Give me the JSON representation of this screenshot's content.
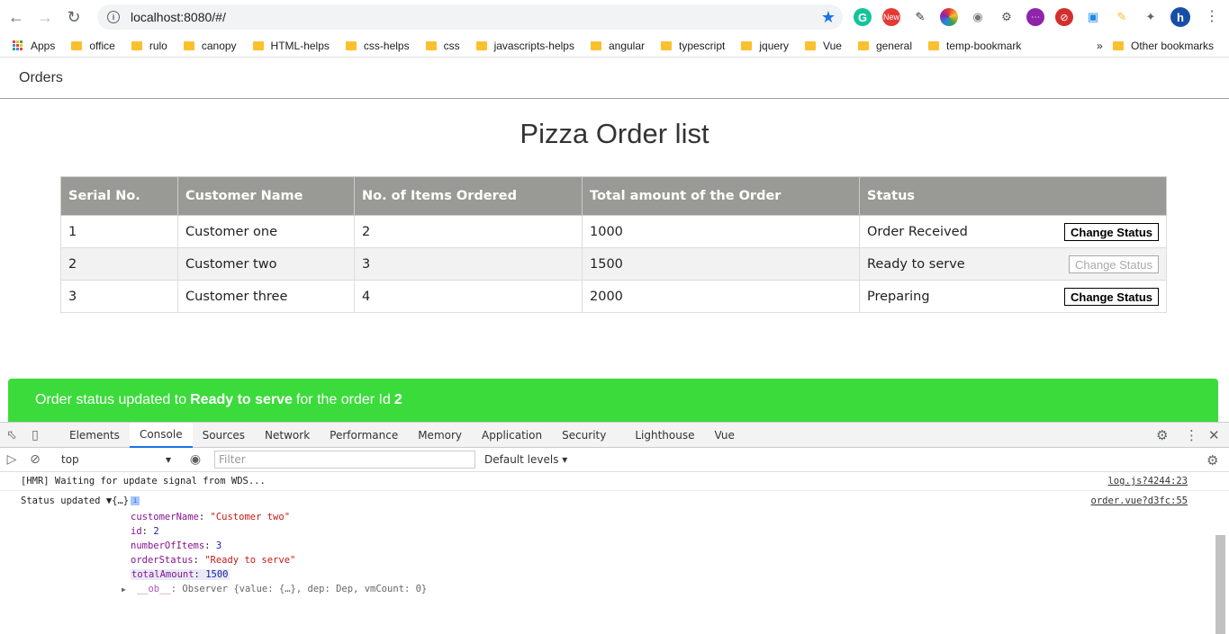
{
  "browser": {
    "url": "localhost:8080/#/",
    "profile_initial": "h",
    "ext_new_badge": "New",
    "bookmarks": [
      "Apps",
      "office",
      "rulo",
      "canopy",
      "HTML-helps",
      "css-helps",
      "css",
      "javascripts-helps",
      "angular",
      "typescript",
      "jquery",
      "Vue",
      "general",
      "temp-bookmark"
    ],
    "more_bookmarks": "»",
    "other_bookmarks": "Other bookmarks"
  },
  "nav": {
    "title": "Orders"
  },
  "page": {
    "title": "Pizza Order list"
  },
  "table": {
    "headers": [
      "Serial No.",
      "Customer Name",
      "No. of Items Ordered",
      "Total amount of the Order",
      "Status"
    ],
    "rows": [
      {
        "serial": "1",
        "customer": "Customer one",
        "items": "2",
        "total": "1000",
        "status": "Order Received",
        "button": "Change Status",
        "disabled": false
      },
      {
        "serial": "2",
        "customer": "Customer two",
        "items": "3",
        "total": "1500",
        "status": "Ready to serve",
        "button": "Change Status",
        "disabled": true
      },
      {
        "serial": "3",
        "customer": "Customer three",
        "items": "4",
        "total": "2000",
        "status": "Preparing",
        "button": "Change Status",
        "disabled": false
      }
    ]
  },
  "alert": {
    "prefix": "Order status updated to",
    "status": "Ready to serve",
    "middle": "for the order Id",
    "id": "2",
    "color": "#3bdb3b"
  },
  "devtools": {
    "tabs": [
      "Elements",
      "Console",
      "Sources",
      "Network",
      "Performance",
      "Memory",
      "Application",
      "Security",
      "Lighthouse",
      "Vue"
    ],
    "active_tab": "Console",
    "context": "top",
    "filter_placeholder": "Filter",
    "levels": "Default levels",
    "lines": [
      {
        "text": "[HMR] Waiting for update signal from WDS...",
        "ref": "log.js?4244:23"
      },
      {
        "text": "Status updated ▼{…} ",
        "ref": "order.vue?d3fc:55"
      }
    ],
    "props": [
      {
        "key": "customerName",
        "value": "\"Customer two\"",
        "type": "string"
      },
      {
        "key": "id",
        "value": "2",
        "type": "number"
      },
      {
        "key": "numberOfItems",
        "value": "3",
        "type": "number"
      },
      {
        "key": "orderStatus",
        "value": "\"Ready to serve\"",
        "type": "string"
      },
      {
        "key": "totalAmount",
        "value": "1500",
        "type": "number"
      },
      {
        "key": "__ob__",
        "value": "Observer {value: {…}, dep: Dep, vmCount: 0}",
        "type": "object"
      }
    ]
  }
}
